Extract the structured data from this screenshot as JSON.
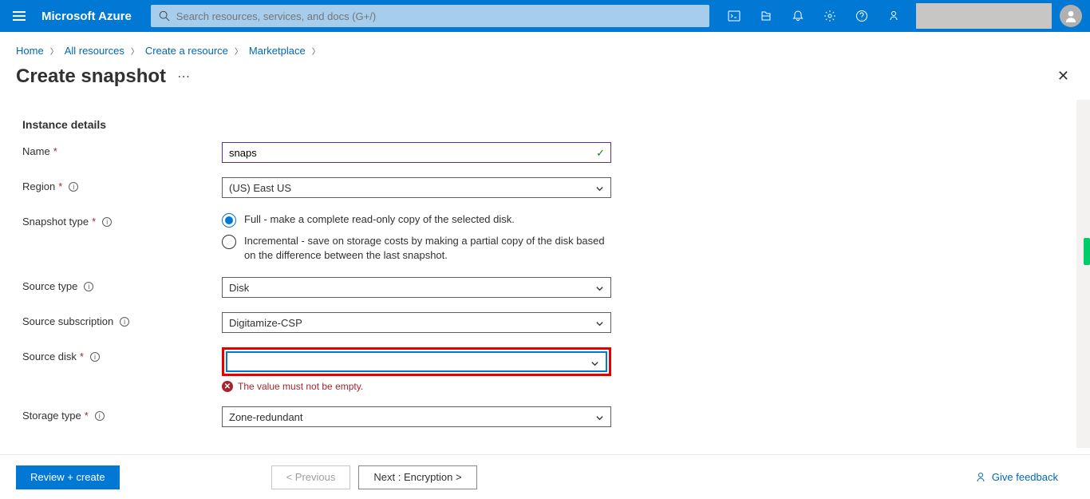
{
  "header": {
    "brand": "Microsoft Azure",
    "search_placeholder": "Search resources, services, and docs (G+/)"
  },
  "breadcrumb": {
    "items": [
      "Home",
      "All resources",
      "Create a resource",
      "Marketplace"
    ]
  },
  "page": {
    "title": "Create snapshot"
  },
  "section": {
    "instance_details": "Instance details"
  },
  "labels": {
    "name": "Name",
    "region": "Region",
    "snapshot_type": "Snapshot type",
    "source_type": "Source type",
    "source_subscription": "Source subscription",
    "source_disk": "Source disk",
    "storage_type": "Storage type"
  },
  "values": {
    "name": "snaps",
    "region": "(US) East US",
    "source_type": "Disk",
    "source_subscription": "Digitamize-CSP",
    "source_disk": "",
    "storage_type": "Zone-redundant"
  },
  "snapshot_options": {
    "full": "Full - make a complete read-only copy of the selected disk.",
    "incremental": "Incremental - save on storage costs by making a partial copy of the disk based on the difference between the last snapshot."
  },
  "errors": {
    "source_disk": "The value must not be empty."
  },
  "footer": {
    "review": "Review + create",
    "previous": "< Previous",
    "next": "Next : Encryption >",
    "feedback": "Give feedback"
  }
}
